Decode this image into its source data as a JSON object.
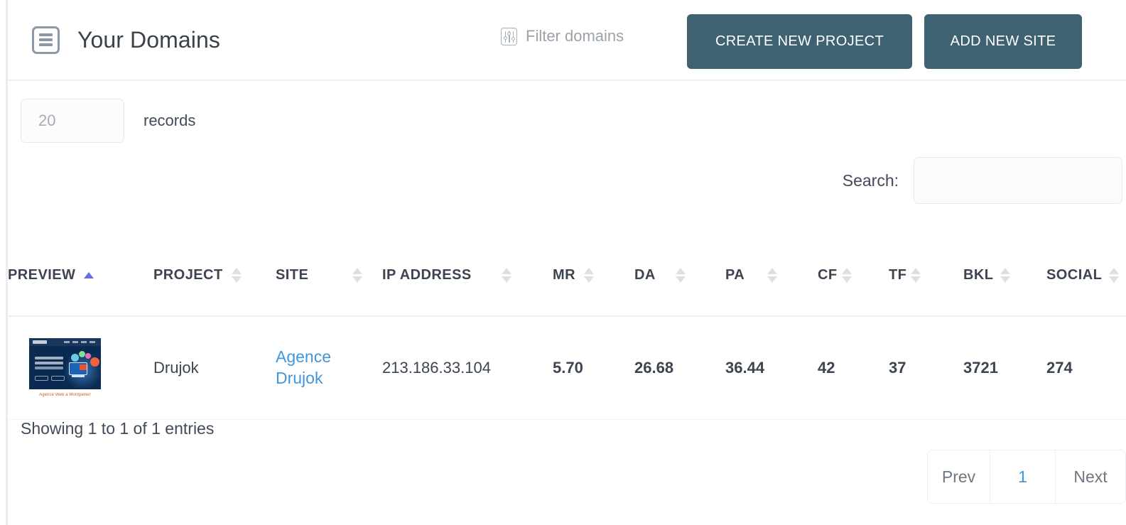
{
  "header": {
    "title": "Your Domains",
    "list_icon": "list-icon",
    "filter": {
      "icon": "sliders-filter-icon",
      "label": "Filter domains"
    },
    "buttons": {
      "create_project": "CREATE NEW PROJECT",
      "add_site": "ADD NEW SITE"
    },
    "button_color": "#3e6271"
  },
  "controls": {
    "records_value": "20",
    "records_placeholder": "20",
    "records_label": "records",
    "search_label": "Search:",
    "search_value": "",
    "search_placeholder": ""
  },
  "table": {
    "columns": [
      {
        "label": "PREVIEW",
        "sort": "asc",
        "align": "left"
      },
      {
        "label": "PROJECT",
        "sort": "none",
        "align": "left"
      },
      {
        "label": "SITE",
        "sort": "none",
        "align": "left"
      },
      {
        "label": "IP ADDRESS",
        "sort": "none",
        "align": "left"
      },
      {
        "label": "MR",
        "sort": "none",
        "align": "left"
      },
      {
        "label": "DA",
        "sort": "none",
        "align": "left"
      },
      {
        "label": "PA",
        "sort": "none",
        "align": "left"
      },
      {
        "label": "CF",
        "sort": "none",
        "align": "left"
      },
      {
        "label": "TF",
        "sort": "none",
        "align": "left"
      },
      {
        "label": "BKL",
        "sort": "none",
        "align": "left"
      },
      {
        "label": "SOCIAL",
        "sort": "none",
        "align": "left"
      }
    ],
    "active_sort_color": "#6b6fe0",
    "rows": [
      {
        "preview_alt": "Agence Drujok website preview",
        "preview_caption": "Agence Web a Montpellier",
        "project": "Drujok",
        "site": "Agence Drujok",
        "site_link_color": "#4196d8",
        "ip_address": "213.186.33.104",
        "mr": "5.70",
        "da": "26.68",
        "pa": "36.44",
        "cf": "42",
        "tf": "37",
        "bkl": "3721",
        "social": "274"
      }
    ]
  },
  "footer": {
    "showing": "Showing 1 to 1 of 1 entries",
    "pagination": {
      "prev": "Prev",
      "current": "1",
      "next": "Next"
    }
  }
}
